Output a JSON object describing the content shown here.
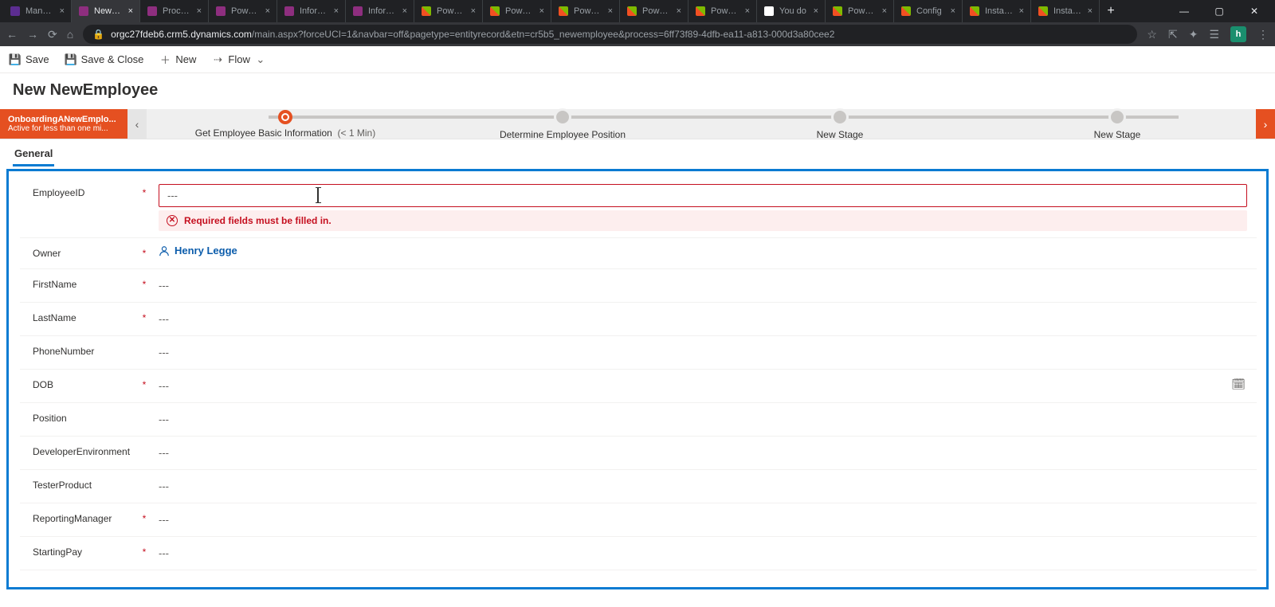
{
  "browser": {
    "tabs": [
      {
        "title": "Manage",
        "favicon": "fc-vs"
      },
      {
        "title": "NewEm",
        "favicon": "fc-pa",
        "active": true
      },
      {
        "title": "Process",
        "favicon": "fc-pa"
      },
      {
        "title": "Power A",
        "favicon": "fc-pa"
      },
      {
        "title": "Informa",
        "favicon": "fc-pa"
      },
      {
        "title": "Informa",
        "favicon": "fc-pa"
      },
      {
        "title": "Power P",
        "favicon": "fc-ms"
      },
      {
        "title": "Power P",
        "favicon": "fc-ms"
      },
      {
        "title": "Power P",
        "favicon": "fc-ms"
      },
      {
        "title": "Power P",
        "favicon": "fc-ms"
      },
      {
        "title": "Power P",
        "favicon": "fc-ms"
      },
      {
        "title": "You do",
        "favicon": "fc-g"
      },
      {
        "title": "Power P",
        "favicon": "fc-ms"
      },
      {
        "title": "Config",
        "favicon": "fc-ms"
      },
      {
        "title": "Install a",
        "favicon": "fc-ms"
      },
      {
        "title": "Install a",
        "favicon": "fc-ms"
      }
    ],
    "url_host": "orgc27fdeb6.crm5.dynamics.com",
    "url_path": "/main.aspx?forceUCI=1&navbar=off&pagetype=entityrecord&etn=cr5b5_newemployee&process=6ff73f89-4dfb-ea11-a813-000d3a80cee2",
    "profile_initial": "h"
  },
  "commands": {
    "save": "Save",
    "save_close": "Save & Close",
    "new": "New",
    "flow": "Flow"
  },
  "page": {
    "title": "New NewEmployee",
    "tab_general": "General"
  },
  "bpf": {
    "process_title": "OnboardingANewEmplo...",
    "process_sub": "Active for less than one mi...",
    "stages": [
      {
        "label": "Get Employee Basic Information",
        "time": "(< 1 Min)",
        "active": true
      },
      {
        "label": "Determine Employee Position",
        "time": "",
        "active": false
      },
      {
        "label": "New Stage",
        "time": "",
        "active": false
      },
      {
        "label": "New Stage",
        "time": "",
        "active": false
      }
    ]
  },
  "form": {
    "error_msg": "Required fields must be filled in.",
    "placeholder": "---",
    "owner_name": "Henry Legge",
    "fields": [
      {
        "label": "EmployeeID",
        "required": true,
        "value": "---",
        "error": true
      },
      {
        "label": "Owner",
        "required": true,
        "type": "owner"
      },
      {
        "label": "FirstName",
        "required": true,
        "value": "---"
      },
      {
        "label": "LastName",
        "required": true,
        "value": "---"
      },
      {
        "label": "PhoneNumber",
        "required": false,
        "value": "---"
      },
      {
        "label": "DOB",
        "required": true,
        "value": "---",
        "type": "date"
      },
      {
        "label": "Position",
        "required": false,
        "value": "---"
      },
      {
        "label": "DeveloperEnvironment",
        "required": false,
        "value": "---"
      },
      {
        "label": "TesterProduct",
        "required": false,
        "value": "---"
      },
      {
        "label": "ReportingManager",
        "required": true,
        "value": "---"
      },
      {
        "label": "StartingPay",
        "required": true,
        "value": "---"
      }
    ]
  }
}
